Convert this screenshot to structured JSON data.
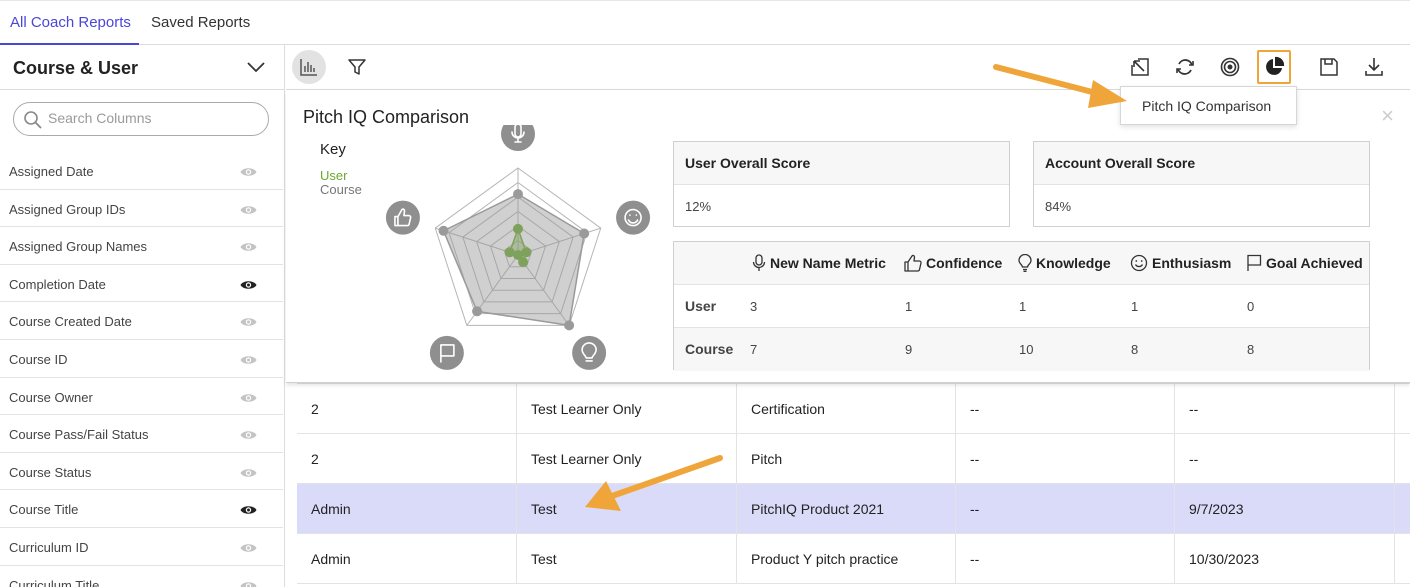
{
  "tabs": [
    "All Coach Reports",
    "Saved Reports"
  ],
  "left_panel": {
    "title": "Course & User",
    "search_placeholder": "Search Columns",
    "columns": [
      {
        "label": "Assigned Date",
        "visible": false
      },
      {
        "label": "Assigned Group IDs",
        "visible": false
      },
      {
        "label": "Assigned Group Names",
        "visible": false
      },
      {
        "label": "Completion Date",
        "visible": true
      },
      {
        "label": "Course Created Date",
        "visible": false
      },
      {
        "label": "Course ID",
        "visible": false
      },
      {
        "label": "Course Owner",
        "visible": false
      },
      {
        "label": "Course Pass/Fail Status",
        "visible": false
      },
      {
        "label": "Course Status",
        "visible": false
      },
      {
        "label": "Course Title",
        "visible": true
      },
      {
        "label": "Curriculum ID",
        "visible": false
      },
      {
        "label": "Curriculum Title",
        "visible": false
      }
    ]
  },
  "toolbar": {
    "left_icons": [
      "bar-chart-icon",
      "filter-icon"
    ],
    "right_icons": [
      "export-arrow-icon",
      "refresh-icon",
      "target-icon",
      "pie-chart-icon",
      "save-icon",
      "download-icon"
    ]
  },
  "tooltip": {
    "label": "Pitch IQ Comparison"
  },
  "card": {
    "title": "Pitch IQ Comparison",
    "close": "×",
    "key": {
      "title": "Key",
      "user": "User",
      "course": "Course"
    },
    "user_overall": {
      "label": "User Overall Score",
      "value": "12%"
    },
    "account_overall": {
      "label": "Account Overall Score",
      "value": "84%"
    },
    "metrics": {
      "headers": [
        "New Name Metric",
        "Confidence",
        "Knowledge",
        "Enthusiasm",
        "Goal Achieved"
      ],
      "rows": [
        {
          "label": "User",
          "values": [
            "3",
            "1",
            "1",
            "1",
            "0"
          ]
        },
        {
          "label": "Course",
          "values": [
            "7",
            "9",
            "10",
            "8",
            "8"
          ]
        }
      ]
    }
  },
  "chart_data": {
    "type": "radar",
    "axes": [
      "New Name Metric",
      "Enthusiasm",
      "Knowledge",
      "Goal Achieved",
      "Confidence"
    ],
    "rmax": 10,
    "series": [
      {
        "name": "User",
        "color": "#6aab2b",
        "values": [
          3,
          1,
          1,
          0,
          1
        ]
      },
      {
        "name": "Course",
        "color": "#999999",
        "values": [
          7,
          8,
          10,
          8,
          9
        ]
      }
    ]
  },
  "table": {
    "rows": [
      {
        "cells": [
          "2",
          "Test Learner Only",
          "Certification",
          "--",
          "--"
        ],
        "selected": false
      },
      {
        "cells": [
          "2",
          "Test Learner Only",
          "Pitch",
          "--",
          "--"
        ],
        "selected": false
      },
      {
        "cells": [
          "Admin",
          "Test",
          "PitchIQ Product 2021",
          "--",
          "9/7/2023"
        ],
        "selected": true
      },
      {
        "cells": [
          "Admin",
          "Test",
          "Product Y pitch practice",
          "--",
          "10/30/2023"
        ],
        "selected": false
      }
    ]
  },
  "colors": {
    "accent": "#4a47d8",
    "annotation": "#f0a53a",
    "selected_row": "#d9dbf8"
  }
}
